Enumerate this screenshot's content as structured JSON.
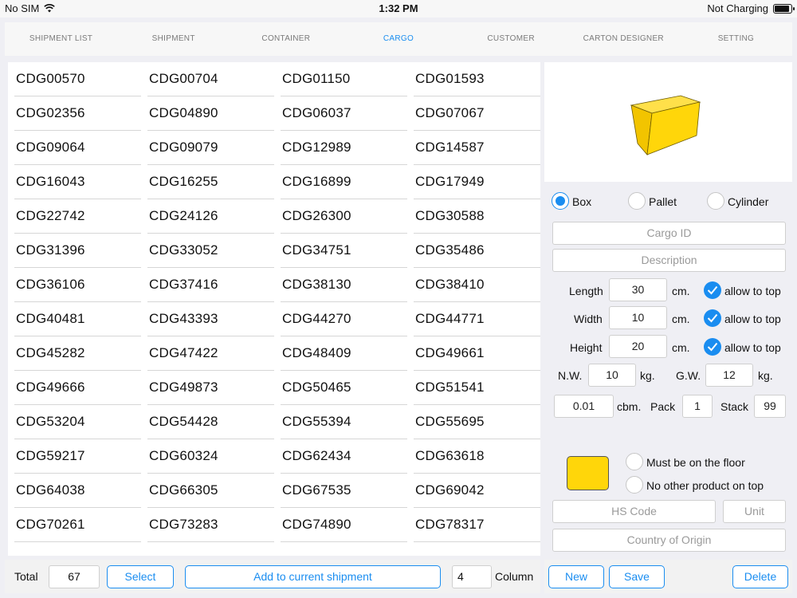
{
  "status_bar": {
    "carrier": "No SIM",
    "time": "1:32 PM",
    "charging": "Not Charging"
  },
  "tabs": [
    {
      "label": "SHIPMENT LIST",
      "active": false
    },
    {
      "label": "SHIPMENT",
      "active": false
    },
    {
      "label": "CONTAINER",
      "active": false
    },
    {
      "label": "CARGO",
      "active": true
    },
    {
      "label": "CUSTOMER",
      "active": false
    },
    {
      "label": "CARTON DESIGNER",
      "active": false
    },
    {
      "label": "SETTING",
      "active": false
    }
  ],
  "cargo_ids": [
    "CDG00570",
    "CDG00704",
    "CDG01150",
    "CDG01593",
    "CDG02356",
    "CDG04890",
    "CDG06037",
    "CDG07067",
    "CDG09064",
    "CDG09079",
    "CDG12989",
    "CDG14587",
    "CDG16043",
    "CDG16255",
    "CDG16899",
    "CDG17949",
    "CDG22742",
    "CDG24126",
    "CDG26300",
    "CDG30588",
    "CDG31396",
    "CDG33052",
    "CDG34751",
    "CDG35486",
    "CDG36106",
    "CDG37416",
    "CDG38130",
    "CDG38410",
    "CDG40481",
    "CDG43393",
    "CDG44270",
    "CDG44771",
    "CDG45282",
    "CDG47422",
    "CDG48409",
    "CDG49661",
    "CDG49666",
    "CDG49873",
    "CDG50465",
    "CDG51541",
    "CDG53204",
    "CDG54428",
    "CDG55394",
    "CDG55695",
    "CDG59217",
    "CDG60324",
    "CDG62434",
    "CDG63618",
    "CDG64038",
    "CDG66305",
    "CDG67535",
    "CDG69042",
    "CDG70261",
    "CDG73283",
    "CDG74890",
    "CDG78317"
  ],
  "bottom_left": {
    "total_label": "Total",
    "total_value": "67",
    "select_label": "Select",
    "add_label": "Add to current shipment",
    "column_value": "4",
    "column_label": "Column"
  },
  "form": {
    "shape_options": [
      {
        "label": "Box",
        "selected": true
      },
      {
        "label": "Pallet",
        "selected": false
      },
      {
        "label": "Cylinder",
        "selected": false
      }
    ],
    "cargo_id_placeholder": "Cargo ID",
    "description_placeholder": "Description",
    "length_label": "Length",
    "length_value": "30",
    "width_label": "Width",
    "width_value": "10",
    "height_label": "Height",
    "height_value": "20",
    "unit_cm": "cm.",
    "allow_to_top": "allow to top",
    "nw_label": "N.W.",
    "nw_value": "10",
    "gw_label": "G.W.",
    "gw_value": "12",
    "unit_kg": "kg.",
    "cbm_value": "0.01",
    "cbm_label": "cbm.",
    "pack_label": "Pack",
    "pack_value": "1",
    "stack_label": "Stack",
    "stack_value": "99",
    "color": "#ffd60a",
    "floor_label": "Must be on the floor",
    "no_other_label": "No other product on top",
    "hs_code_placeholder": "HS Code",
    "unit_placeholder": "Unit",
    "origin_placeholder": "Country of Origin"
  },
  "bottom_right": {
    "new_label": "New",
    "save_label": "Save",
    "delete_label": "Delete"
  },
  "accent_color": "#1a8df0",
  "icons": {
    "wifi": "wifi-icon",
    "battery": "battery-icon",
    "checkmark": "checkmark-icon",
    "box_preview": "cargo-box-3d-icon"
  }
}
